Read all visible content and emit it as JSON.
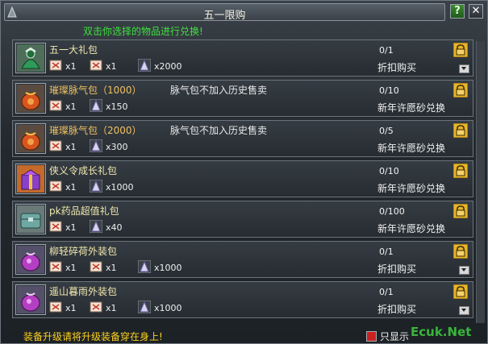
{
  "window": {
    "title": "五一限购",
    "help_label": "?",
    "close_label": "✕"
  },
  "hint": "双击你选择的物品进行兑换!",
  "items": [
    {
      "name": "五一大礼包",
      "name_color": "#f3e9b0",
      "note": "",
      "icon": "green-gift-bag-icon",
      "costs": [
        {
          "icon": "ticket-icon",
          "value": "x1"
        },
        {
          "icon": "ticket-icon",
          "value": "x1"
        },
        {
          "icon": "sand-icon",
          "value": "x2000"
        }
      ],
      "count": "0/1",
      "action": "折扣购买",
      "expandable": true
    },
    {
      "name": "璀璨脉气包（1000）",
      "name_color": "#f0c060",
      "note": "脉气包不加入历史售卖",
      "icon": "orange-pouch-icon",
      "costs": [
        {
          "icon": "ticket-icon",
          "value": "x1"
        },
        {
          "icon": "sand-icon",
          "value": "x150"
        }
      ],
      "count": "0/10",
      "action": "新年许愿砂兑换",
      "expandable": false
    },
    {
      "name": "璀璨脉气包（2000）",
      "name_color": "#f0c060",
      "note": "脉气包不加入历史售卖",
      "icon": "orange-pouch-icon",
      "costs": [
        {
          "icon": "ticket-icon",
          "value": "x1"
        },
        {
          "icon": "sand-icon",
          "value": "x300"
        }
      ],
      "count": "0/5",
      "action": "新年许愿砂兑换",
      "expandable": false
    },
    {
      "name": "侠义令成长礼包",
      "name_color": "#f3e9b0",
      "note": "",
      "icon": "purple-gift-box-icon",
      "costs": [
        {
          "icon": "ticket-icon",
          "value": "x1"
        },
        {
          "icon": "sand-icon",
          "value": "x1000"
        }
      ],
      "count": "0/10",
      "action": "新年许愿砂兑换",
      "expandable": false
    },
    {
      "name": "pk药品超值礼包",
      "name_color": "#f3e9b0",
      "note": "",
      "icon": "teal-chest-icon",
      "costs": [
        {
          "icon": "ticket-icon",
          "value": "x1"
        },
        {
          "icon": "sand-icon",
          "value": "x40"
        }
      ],
      "count": "0/100",
      "action": "新年许愿砂兑换",
      "expandable": false
    },
    {
      "name": "柳轻碎荷外装包",
      "name_color": "#f3e9b0",
      "note": "",
      "icon": "purple-pouch-icon",
      "costs": [
        {
          "icon": "ticket-icon",
          "value": "x1"
        },
        {
          "icon": "ticket-icon",
          "value": "x1"
        },
        {
          "icon": "sand-icon",
          "value": "x1000"
        }
      ],
      "count": "0/1",
      "action": "折扣购买",
      "expandable": true
    },
    {
      "name": "遥山暮雨外装包",
      "name_color": "#f3e9b0",
      "note": "",
      "icon": "purple-pouch-icon",
      "costs": [
        {
          "icon": "ticket-icon",
          "value": "x1"
        },
        {
          "icon": "ticket-icon",
          "value": "x1"
        },
        {
          "icon": "sand-icon",
          "value": "x1000"
        }
      ],
      "count": "0/1",
      "action": "折扣购买",
      "expandable": true
    }
  ],
  "footer": {
    "hint": "装备升级请将升级装备穿在身上!",
    "checkbox_label": "只显示",
    "checkbox_checked": true,
    "watermark": "Ecuk.Net"
  },
  "colors": {
    "hint_green": "#40e040",
    "footer_yellow": "#ffd21f",
    "cost_qty": "#f0f0f0"
  }
}
